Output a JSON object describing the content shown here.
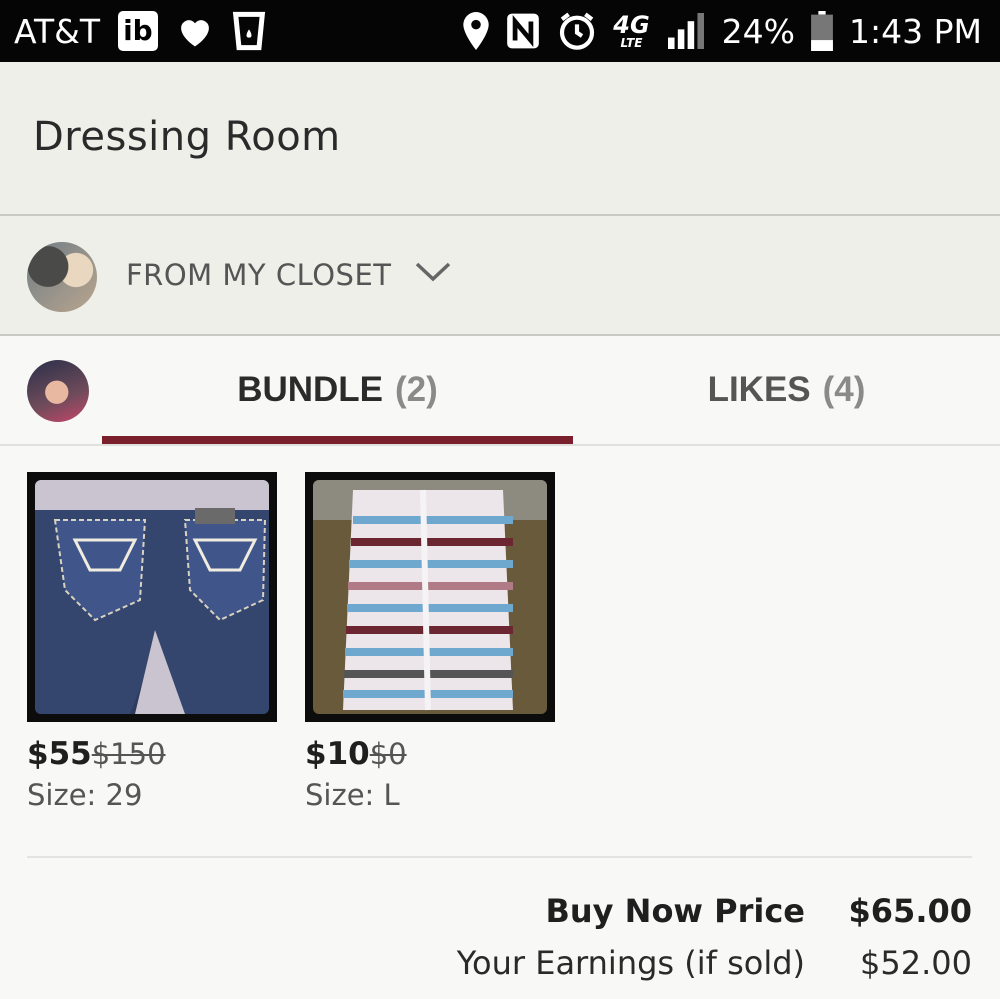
{
  "status_bar": {
    "carrier": "AT&T",
    "ib_label": "ib",
    "network": "4G",
    "network_sub": "LTE",
    "battery": "24%",
    "time": "1:43 PM"
  },
  "header": {
    "title": "Dressing Room"
  },
  "closet": {
    "label": "FROM MY CLOSET"
  },
  "tabs": [
    {
      "label": "BUNDLE",
      "count": "(2)",
      "active": true
    },
    {
      "label": "LIKES",
      "count": "(4)",
      "active": false
    }
  ],
  "items": [
    {
      "price": "$55",
      "original_price": "$150",
      "size": "Size: 29"
    },
    {
      "price": "$10",
      "original_price": "$0",
      "size": "Size: L"
    }
  ],
  "totals": {
    "buy_now_label": "Buy Now Price",
    "buy_now_value": "$65.00",
    "earnings_label": "Your Earnings (if sold)",
    "earnings_value": "$52.00"
  },
  "colors": {
    "accent": "#7a1f2c",
    "status_bar": "#050505",
    "header_bg": "#efefea"
  }
}
